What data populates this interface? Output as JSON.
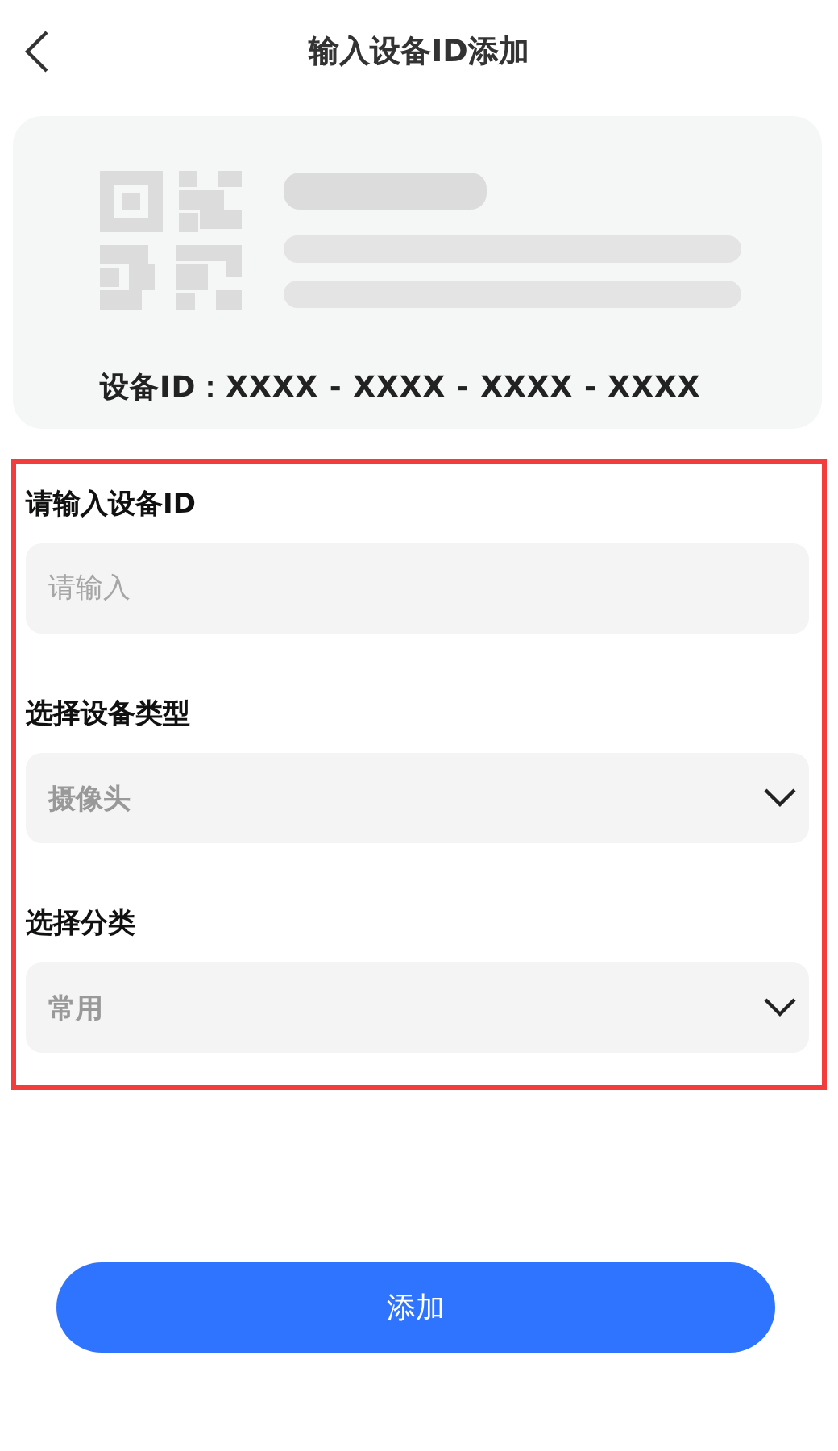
{
  "header": {
    "title": "输入设备ID添加"
  },
  "card": {
    "device_id": "设备ID：XXXX - XXXX - XXXX - XXXX"
  },
  "form": {
    "highlighted": true,
    "fields": [
      {
        "label": "请输入设备ID",
        "kind": "input",
        "placeholder": "请输入"
      },
      {
        "label": "选择设备类型",
        "kind": "select",
        "value": "摄像头"
      },
      {
        "label": "选择分类",
        "kind": "select",
        "value": "常用"
      }
    ]
  },
  "submit": {
    "label": "添加"
  }
}
